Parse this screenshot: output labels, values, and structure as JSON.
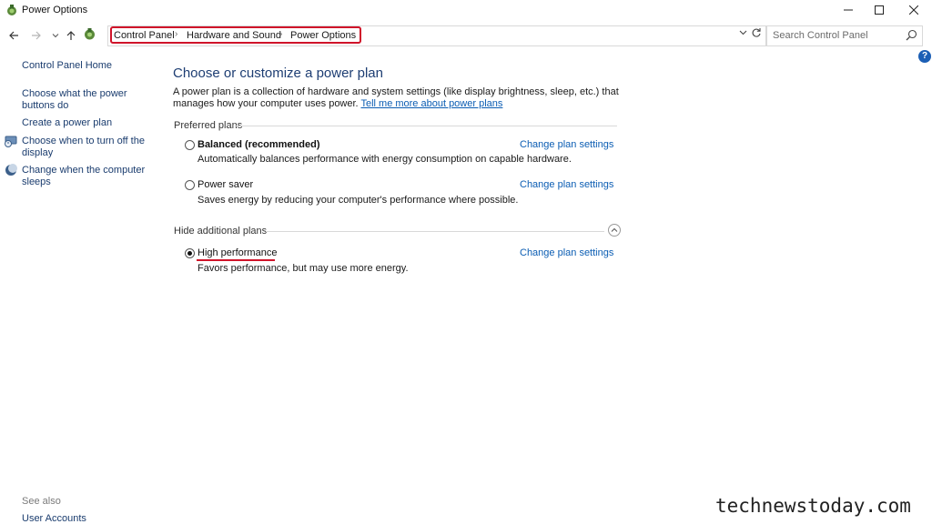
{
  "window": {
    "title": "Power Options",
    "icon": "power-options-icon",
    "controls": {
      "minimize": "—",
      "maximize": "☐",
      "close": "✕"
    }
  },
  "address_bar": {
    "breadcrumbs": [
      "Control Panel",
      "Hardware and Sound",
      "Power Options"
    ],
    "separator": "›",
    "highlight_color": "#d0142a"
  },
  "search": {
    "placeholder": "Search Control Panel"
  },
  "left_pane": {
    "home": "Control Panel Home",
    "links": [
      "Choose what the power buttons do",
      "Create a power plan",
      "Choose when to turn off the display",
      "Change when the computer sleeps"
    ],
    "see_also_label": "See also",
    "see_also_links": [
      "User Accounts"
    ]
  },
  "main": {
    "title": "Choose or customize a power plan",
    "description": "A power plan is a collection of hardware and system settings (like display brightness, sleep, etc.) that manages how your computer uses power.",
    "description_link": "Tell me more about power plans",
    "preferred_heading": "Preferred plans",
    "additional_heading": "Hide additional plans",
    "change_link": "Change plan settings",
    "plans": [
      {
        "name": "Balanced (recommended)",
        "description": "Automatically balances performance with energy consumption on capable hardware.",
        "selected": false
      },
      {
        "name": "Power saver",
        "description": "Saves energy by reducing your computer's performance where possible.",
        "selected": false
      },
      {
        "name": "High performance",
        "description": "Favors performance, but may use more energy.",
        "selected": true
      }
    ]
  },
  "watermark": "technewstoday.com",
  "colors": {
    "title_blue": "#1e3e73",
    "link_blue": "#0b5db3",
    "accent_red": "#d0142a",
    "help_blue": "#1c5fb5"
  }
}
